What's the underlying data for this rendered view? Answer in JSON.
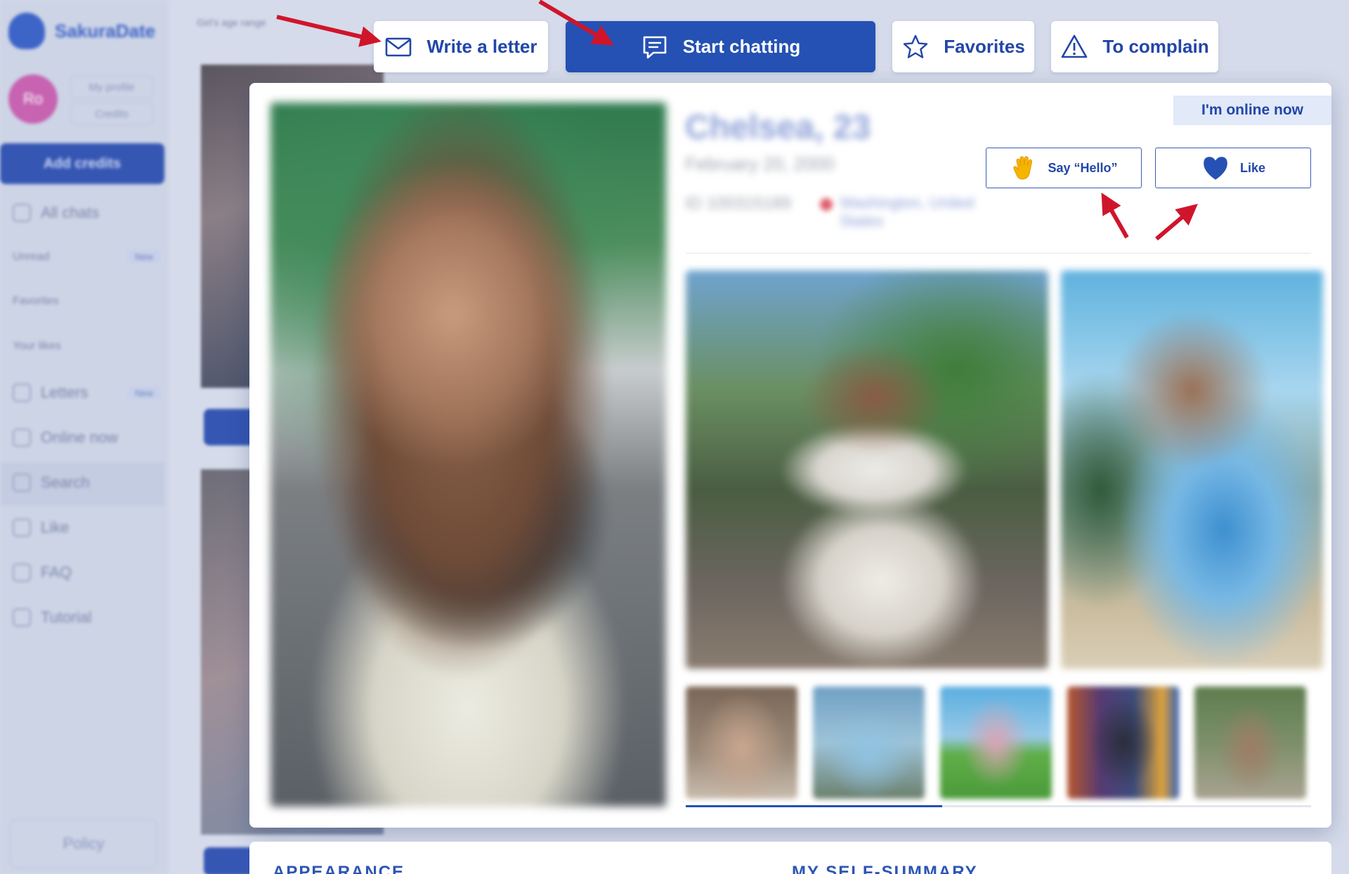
{
  "background_app": {
    "brand": "SakuraDate",
    "avatar_initials": "Ro",
    "profile_link": "My profile",
    "credits_link": "Credits",
    "add_credits": "Add credits",
    "menu": [
      {
        "label": "All chats",
        "badge": ""
      },
      {
        "label": "Unread",
        "badge": "New"
      },
      {
        "label": "Favorites",
        "badge": ""
      },
      {
        "label": "Your likes",
        "badge": ""
      },
      {
        "label": "Letters",
        "badge": "New"
      },
      {
        "label": "Online now",
        "badge": ""
      },
      {
        "label": "Search",
        "badge": ""
      },
      {
        "label": "Like",
        "badge": ""
      },
      {
        "label": "FAQ",
        "badge": ""
      },
      {
        "label": "Tutorial",
        "badge": ""
      }
    ],
    "policy": "Policy",
    "filter_label": "Girl's age range"
  },
  "actions": {
    "write_letter": "Write a letter",
    "start_chatting": "Start chatting",
    "favorites": "Favorites",
    "complain": "To complain"
  },
  "profile": {
    "online_status": "I'm online now",
    "name_age": "Chelsea, 23",
    "birthdate": "February 20, 2000",
    "id": "ID 100315189",
    "location": "Washington, United States",
    "say_hello": "Say “Hello”",
    "like": "Like",
    "gallery_progress": 0.41
  },
  "sections": {
    "appearance": "APPEARANCE",
    "self_summary": "MY SELF-SUMMARY"
  },
  "colors": {
    "accent": "#2451b3",
    "annotation_arrow": "#d0152a",
    "heart": "#2451b3",
    "hand": "#f5b400"
  }
}
